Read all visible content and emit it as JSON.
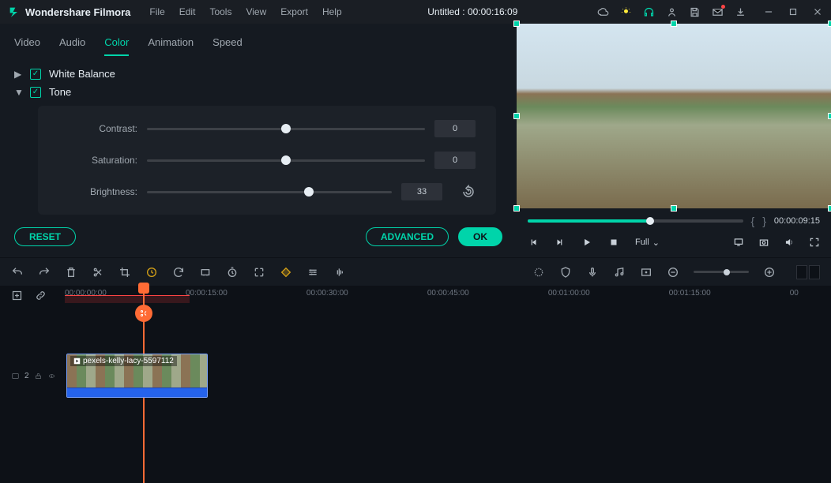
{
  "app": {
    "name": "Wondershare Filmora"
  },
  "menu": [
    "File",
    "Edit",
    "Tools",
    "View",
    "Export",
    "Help"
  ],
  "title": "Untitled : 00:00:16:09",
  "tabs": {
    "items": [
      "Video",
      "Audio",
      "Color",
      "Animation",
      "Speed"
    ],
    "active": 2
  },
  "sections": {
    "white_balance": {
      "label": "White Balance",
      "expanded": false,
      "checked": true
    },
    "tone": {
      "label": "Tone",
      "expanded": true,
      "checked": true
    }
  },
  "tone": {
    "sliders": [
      {
        "label": "Contrast:",
        "value": "0",
        "pct": 50
      },
      {
        "label": "Saturation:",
        "value": "0",
        "pct": 50
      },
      {
        "label": "Brightness:",
        "value": "33",
        "pct": 66
      }
    ]
  },
  "buttons": {
    "reset": "RESET",
    "advanced": "ADVANCED",
    "ok": "OK"
  },
  "preview": {
    "time": "00:00:09:15",
    "progress_pct": 57,
    "scale_label": "Full"
  },
  "ruler": {
    "ticks": [
      {
        "label": "00:00:00:00",
        "pct": 0
      },
      {
        "label": "00:00:15:00",
        "pct": 16
      },
      {
        "label": "00:00:30:00",
        "pct": 32
      },
      {
        "label": "00:00:45:00",
        "pct": 48
      },
      {
        "label": "00:01:00:00",
        "pct": 64
      },
      {
        "label": "00:01:15:00",
        "pct": 80
      },
      {
        "label": "00",
        "pct": 96
      }
    ],
    "playhead_pct": 10.5,
    "played_pct": 16.5
  },
  "track": {
    "num": "2",
    "clip_label": "pexels-kelly-lacy-5597112",
    "clip_left_pct": 0,
    "clip_width_pct": 17.5
  }
}
